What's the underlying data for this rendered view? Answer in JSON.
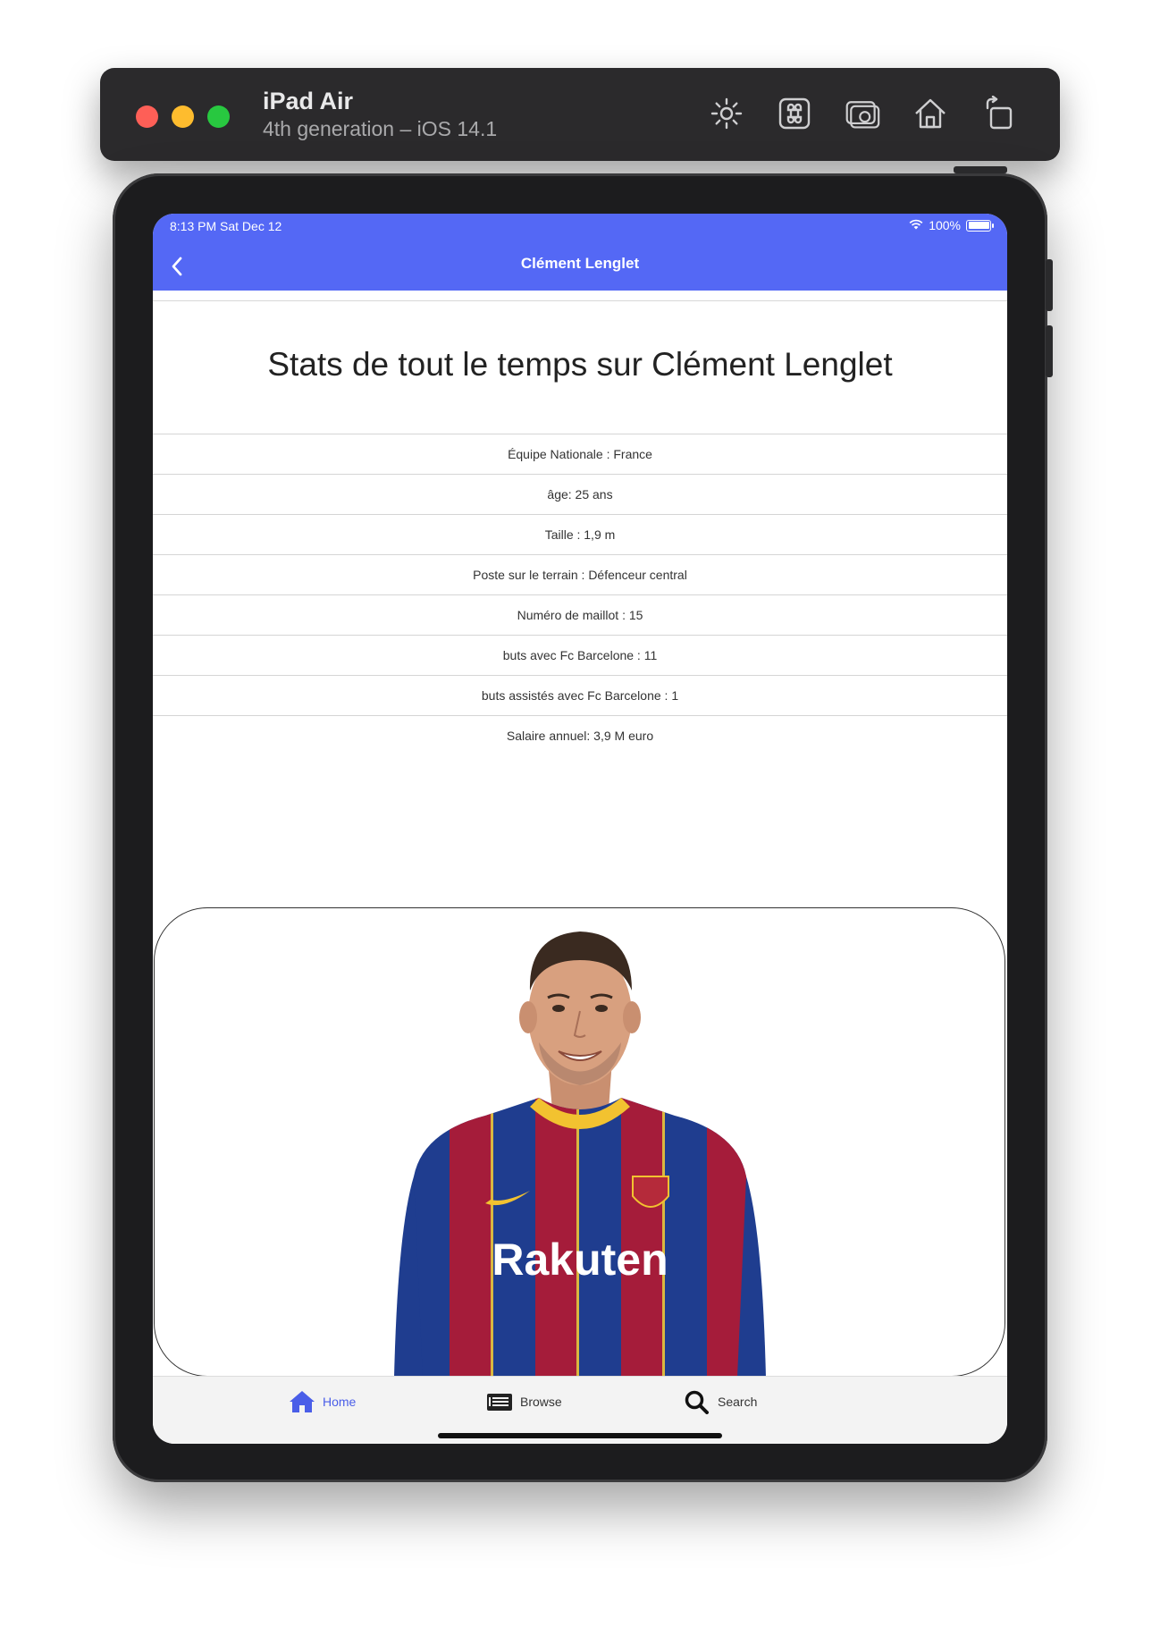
{
  "simulator": {
    "device_name": "iPad Air",
    "device_subtitle": "4th generation – iOS 14.1",
    "tools": [
      "brightness-icon",
      "command-icon",
      "screenshot-icon",
      "home-icon",
      "rotate-icon"
    ]
  },
  "status_bar": {
    "time": "8:13 PM   Sat Dec 12",
    "battery": "100%"
  },
  "nav": {
    "title": "Clément Lenglet",
    "color": "#5468f5"
  },
  "page": {
    "title": "Stats de tout le temps sur Clément Lenglet"
  },
  "stats": [
    "Équipe Nationale : France",
    "âge: 25 ans",
    "Taille : 1,9 m",
    "Poste sur le terrain : Défenceur central",
    "Numéro de  maillot : 15",
    "buts avec Fc Barcelone  : 11",
    "buts assistés avec Fc Barcelone  : 1",
    "Salaire annuel: 3,9 M euro"
  ],
  "photo": {
    "jersey_text": "Rakuten"
  },
  "tabs": [
    {
      "label": "Home",
      "icon": "home-icon",
      "active": true
    },
    {
      "label": "Browse",
      "icon": "browse-icon",
      "active": false
    },
    {
      "label": "Search",
      "icon": "search-icon",
      "active": false
    }
  ],
  "colors": {
    "accent": "#5468f5",
    "tab_active": "#4a5ee8",
    "tab_inactive": "#333333"
  }
}
